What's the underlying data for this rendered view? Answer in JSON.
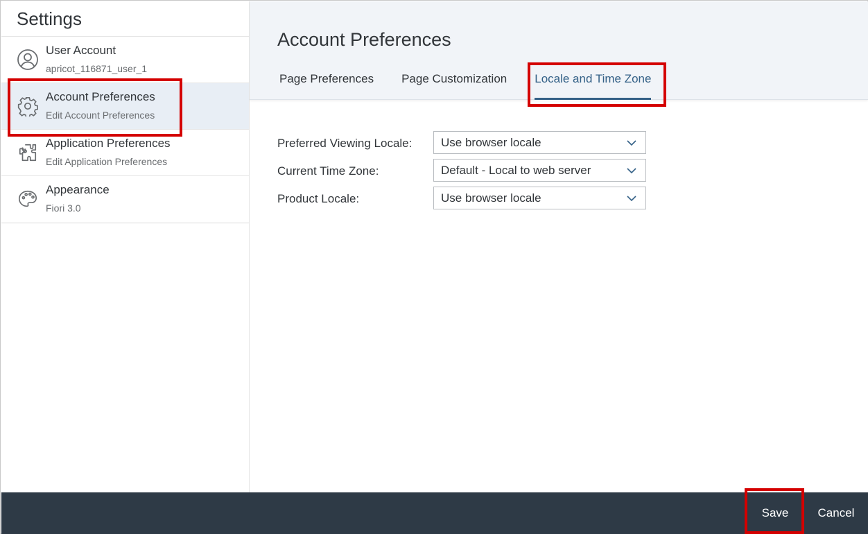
{
  "sidebar": {
    "title": "Settings",
    "items": [
      {
        "title": "User Account",
        "subtitle": "apricot_116871_user_1",
        "icon": "user-circle-icon"
      },
      {
        "title": "Account Preferences",
        "subtitle": "Edit Account Preferences",
        "icon": "gear-icon",
        "selected": true
      },
      {
        "title": "Application Preferences",
        "subtitle": "Edit Application Preferences",
        "icon": "app-puzzle-icon"
      },
      {
        "title": "Appearance",
        "subtitle": "Fiori 3.0",
        "icon": "palette-icon"
      }
    ]
  },
  "main": {
    "title": "Account Preferences",
    "tabs": [
      {
        "label": "Page Preferences"
      },
      {
        "label": "Page Customization"
      },
      {
        "label": "Locale and Time Zone",
        "active": true
      }
    ],
    "form": {
      "fields": [
        {
          "label": "Preferred Viewing Locale:",
          "value": "Use browser locale"
        },
        {
          "label": "Current Time Zone:",
          "value": "Default - Local to web server"
        },
        {
          "label": "Product Locale:",
          "value": "Use browser locale"
        }
      ]
    }
  },
  "footer": {
    "save_label": "Save",
    "cancel_label": "Cancel"
  },
  "colors": {
    "accent": "#346187",
    "footer_bg": "#2e3a46",
    "selected_bg": "#e8eef5",
    "highlight": "#d40000"
  }
}
